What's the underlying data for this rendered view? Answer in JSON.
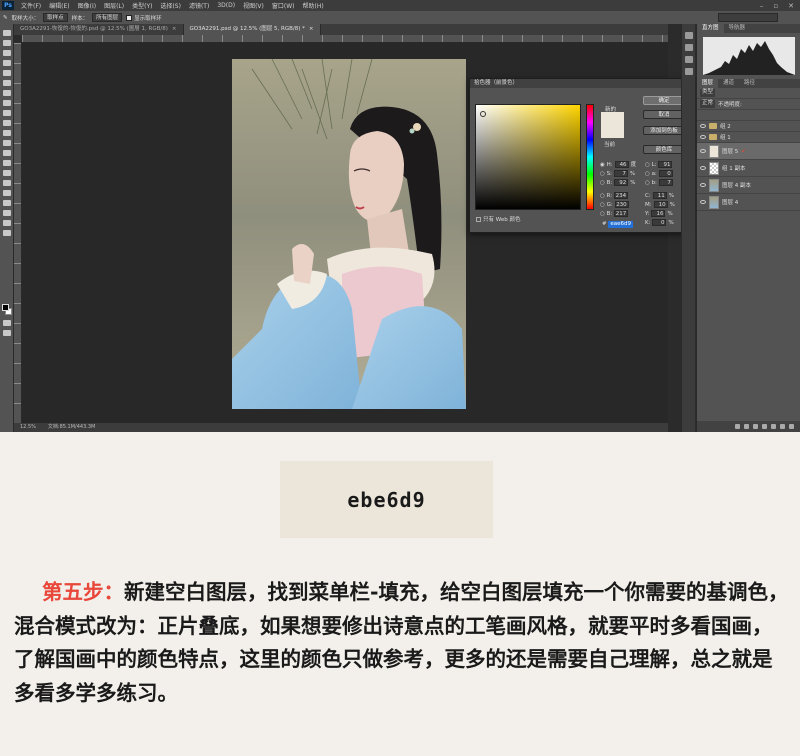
{
  "ps": {
    "app_badge": "Ps",
    "menu": [
      "文件(F)",
      "编辑(E)",
      "图像(I)",
      "图层(L)",
      "类型(Y)",
      "选择(S)",
      "滤镜(T)",
      "3D(D)",
      "视图(V)",
      "窗口(W)",
      "帮助(H)"
    ],
    "options": {
      "sample_label": "取样大小：",
      "sample_value": "取样点",
      "pattern_label": "样本：",
      "pattern_value": "所有图层",
      "show_ring": "显示取样环"
    },
    "tabs": [
      {
        "label": "GO3A2291-恢復的-恢復的.psd @ 12.5% (圖層 1, RGB/8)",
        "close": "×"
      },
      {
        "label": "GO3A2291.psd @ 12.5% (图层 5, RGB/8) *",
        "close": "×"
      }
    ],
    "status": {
      "zoom": "12.5%",
      "doc": "文档:85.1M/443.3M"
    }
  },
  "picker": {
    "title": "拾色器（前景色）",
    "new_label": "新的",
    "current_label": "当前",
    "buttons": {
      "ok": "确定",
      "cancel": "取消",
      "add_swatch": "添加到色板",
      "libraries": "颜色库"
    },
    "hsb": [
      {
        "k": "H:",
        "v": "46",
        "u": "度"
      },
      {
        "k": "S:",
        "v": "7",
        "u": "%"
      },
      {
        "k": "B:",
        "v": "92",
        "u": "%"
      }
    ],
    "rgb": [
      {
        "k": "R:",
        "v": "234"
      },
      {
        "k": "G:",
        "v": "230"
      },
      {
        "k": "B:",
        "v": "217"
      }
    ],
    "lab": [
      {
        "k": "L:",
        "v": "91"
      },
      {
        "k": "a:",
        "v": "0"
      },
      {
        "k": "b:",
        "v": "7"
      }
    ],
    "cmyk": [
      {
        "k": "C:",
        "v": "11",
        "u": "%"
      },
      {
        "k": "M:",
        "v": "10",
        "u": "%"
      },
      {
        "k": "Y:",
        "v": "16",
        "u": "%"
      },
      {
        "k": "K:",
        "v": "0",
        "u": "%"
      }
    ],
    "web_only": "只有 Web 颜色",
    "hex_prefix": "#",
    "hex": "eae6d9",
    "color_new": "#ebe6d9"
  },
  "panels": {
    "top_tabs": [
      "直方图",
      "导航器"
    ],
    "layer_tabs": [
      "图层",
      "通道",
      "路径"
    ],
    "kind_label": "类型",
    "blend": "正常",
    "opacity_label": "不透明度:",
    "layers": [
      {
        "name": "组 2",
        "kind": "group"
      },
      {
        "name": "组 1",
        "kind": "group"
      },
      {
        "name": "图层 5",
        "kind": "fill",
        "active": true
      },
      {
        "name": "组 1 副本",
        "kind": "checker"
      },
      {
        "name": "图层 4 副本",
        "kind": "image"
      },
      {
        "name": "图层 4",
        "kind": "image"
      }
    ]
  },
  "colors": {
    "accent_red": "#e8473a",
    "base_tone": "#ebe6d9"
  },
  "hex_display": "ebe6d9",
  "article": {
    "step_label": "第五步：",
    "body": "新建空白图层，找到菜单栏-填充，给空白图层填充一个你需要的基调色，混合模式改为：正片叠底，如果想要修出诗意点的工笔画风格，就要平时多看国画，了解国画中的颜色特点，这里的颜色只做参考，更多的还是需要自己理解，总之就是多看多学多练习。"
  }
}
